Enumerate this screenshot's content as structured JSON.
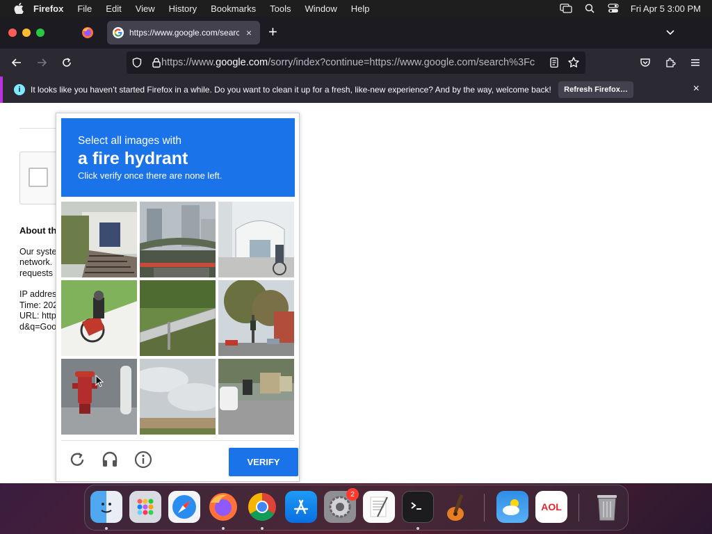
{
  "menubar": {
    "app": "Firefox",
    "items": [
      "File",
      "Edit",
      "View",
      "History",
      "Bookmarks",
      "Tools",
      "Window",
      "Help"
    ],
    "clock": "Fri Apr 5  3:00 PM"
  },
  "tab": {
    "title": "https://www.google.com/search?",
    "close": "×"
  },
  "newtab": "+",
  "urlbar": {
    "prefix": "https://www.",
    "host": "google.com",
    "rest": "/sorry/index?continue=https://www.google.com/search%3Fc"
  },
  "notice": {
    "message": "It looks like you haven’t started Firefox in a while. Do you want to clean it up for a fresh, like-new experience? And by the way, welcome back!",
    "button": "Refresh Firefox…",
    "close": "×"
  },
  "page": {
    "about": "About th",
    "lines": [
      "Our syste",
      "network.",
      "requests"
    ],
    "ip_lines": [
      "IP addres",
      "Time: 202",
      "URL: http",
      "d&q=Goo"
    ]
  },
  "captcha": {
    "line1": "Select all images with",
    "line2": "a fire hydrant",
    "line3": "Click verify once there are none left.",
    "verify": "VERIFY"
  },
  "dock": {
    "badge": "2",
    "aol": "AOL"
  },
  "colors": {
    "captcha_blue": "#1a73e8",
    "notice_accent": "#b833e1"
  }
}
